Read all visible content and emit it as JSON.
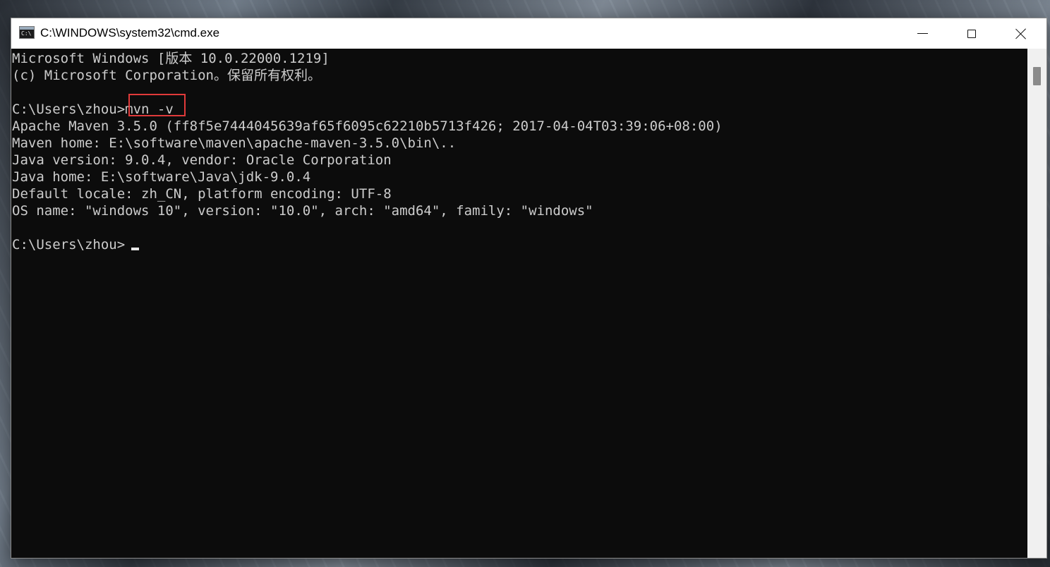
{
  "window": {
    "title": "C:\\WINDOWS\\system32\\cmd.exe",
    "icon": "cmd-terminal-icon",
    "icon_glyph": "C:\\"
  },
  "controls": {
    "minimize": "minimize-icon",
    "maximize": "maximize-icon",
    "close": "close-icon"
  },
  "console": {
    "lines": [
      "Microsoft Windows [版本 10.0.22000.1219]",
      "(c) Microsoft Corporation。保留所有权利。",
      "",
      "C:\\Users\\zhou>mvn -v",
      "Apache Maven 3.5.0 (ff8f5e7444045639af65f6095c62210b5713f426; 2017-04-04T03:39:06+08:00)",
      "Maven home: E:\\software\\maven\\apache-maven-3.5.0\\bin\\..",
      "Java version: 9.0.4, vendor: Oracle Corporation",
      "Java home: E:\\software\\Java\\jdk-9.0.4",
      "Default locale: zh_CN, platform encoding: UTF-8",
      "OS name: \"windows 10\", version: \"10.0\", arch: \"amd64\", family: \"windows\"",
      "",
      "C:\\Users\\zhou>"
    ],
    "highlighted_command": "mvn -v",
    "highlight_color": "#e03a3a",
    "text_color": "#cccccc",
    "background_color": "#0c0c0c"
  }
}
